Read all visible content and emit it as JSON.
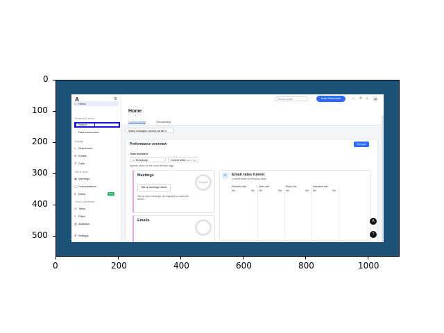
{
  "sidebar": {
    "logo": "A",
    "collapse_icon": "⊞",
    "sections": {
      "prospect": "Prospect & enrich",
      "engage": "Engage",
      "win": "Win & close",
      "tools": "Tools & workflows"
    },
    "items": {
      "home": "Home",
      "search": "Search",
      "data_enrichment": "Data enrichment",
      "sequences": "Sequences",
      "emails": "Emails",
      "calls": "Calls",
      "meetings": "Meetings",
      "conversations": "Conversations",
      "deals": "Deals",
      "tasks": "Tasks",
      "plays": "Plays",
      "analytics": "Analytics",
      "settings": "Settings"
    },
    "deals_badge": "New"
  },
  "topbar": {
    "search_placeholder": "Search Apollo",
    "invite_label": "Invite Teammates",
    "avatar": "SM"
  },
  "header": {
    "title": "Home",
    "tabs": [
      "Control center",
      "Onboarding"
    ]
  },
  "control_center_select": "Sales manager control center",
  "performance": {
    "title": "Performance overview",
    "set_goal": "Set goal",
    "team_members_label": "Team members",
    "team_select": "Everybody",
    "period_select": "Current week",
    "period_range": "Jan 22 - Jan 28",
    "hint": "Specify users for the most relevant data"
  },
  "meetings_card": {
    "title": "Meetings",
    "button": "Set up meetings metric",
    "ring_label": "Set goal",
    "desc": "Set up your meetings set mapping to track this metric."
  },
  "emails_card": {
    "title": "Emails"
  },
  "funnel": {
    "title": "Email rates funnel",
    "subtitle": "Current week vs Previous week",
    "metrics": [
      {
        "name": "Delivered rate",
        "current": "0%",
        "previous": "0%"
      },
      {
        "name": "Open rate",
        "current": "0%",
        "previous": "0%"
      },
      {
        "name": "Reply rate",
        "current": "0%",
        "previous": "0%"
      },
      {
        "name": "Interested rate",
        "current": "0%",
        "previous": "0%"
      }
    ]
  },
  "axes": {
    "x_ticks": [
      "0",
      "200",
      "400",
      "600",
      "800",
      "1000"
    ],
    "y_ticks": [
      "0",
      "100",
      "200",
      "300",
      "400",
      "500"
    ]
  },
  "colors": {
    "frame_bg": "#1b5276",
    "accent": "#2e6bf2",
    "highlight_box": "#1414dd"
  }
}
